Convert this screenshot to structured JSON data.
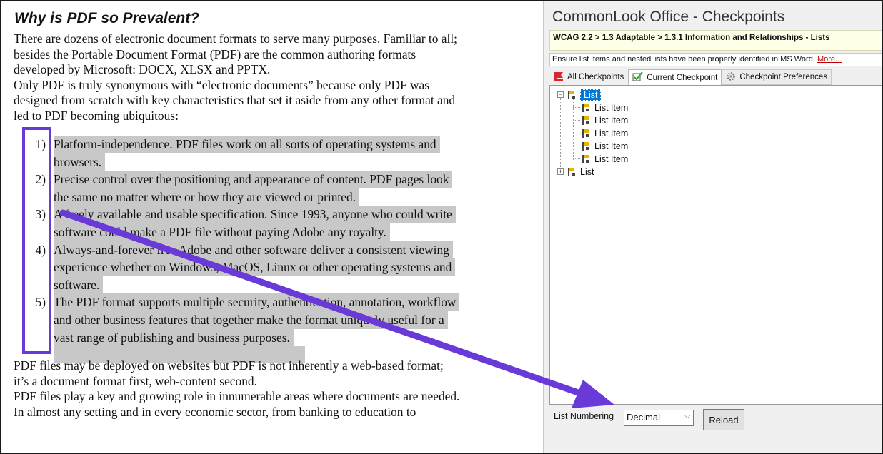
{
  "document": {
    "heading": "Why is PDF so Prevalent?",
    "intro_lines": [
      "There are dozens of electronic document formats to serve many purposes. Familiar to all;",
      "besides the Portable Document Format (PDF) are the common authoring formats",
      "developed by Microsoft: DOCX, XLSX and PPTX.",
      "Only PDF is truly synonymous with “electronic documents” because only PDF was",
      "designed from scratch with key characteristics that set it aside from any other format and",
      "led to PDF becoming ubiquitous:"
    ],
    "list_items": [
      {
        "number": "1)",
        "lines": [
          "Platform-independence. PDF files work on all sorts of operating systems and",
          "browsers."
        ]
      },
      {
        "number": "2)",
        "lines": [
          "Precise control over the positioning and appearance of content. PDF pages look",
          "the same no matter where or how they are viewed or printed."
        ]
      },
      {
        "number": "3)",
        "lines": [
          "A freely available and usable specification. Since 1993, anyone who could write",
          "software could make a PDF file without paying Adobe any royalty."
        ]
      },
      {
        "number": "4)",
        "lines": [
          "Always-and-forever free Adobe and other software deliver a consistent viewing",
          "experience whether on Windows, MacOS, Linux or other operating systems and",
          "software."
        ]
      },
      {
        "number": "5)",
        "lines": [
          "The PDF format supports multiple security, authentication, annotation, workflow",
          "and other business features that together make the format uniquely useful for a",
          "vast range of publishing and business purposes."
        ]
      }
    ],
    "outro_lines": [
      "PDF files may be deployed on websites but PDF is not inherently a web-based format;",
      "it’s a document format first, web-content second.",
      "PDF files play a key and growing role in innumerable areas where documents are needed.",
      "In almost any setting and in every economic sector, from banking to education to"
    ]
  },
  "commonlook": {
    "title": "CommonLook Office - Checkpoints",
    "breadcrumb": "WCAG 2.2 > 1.3 Adaptable > 1.3.1 Information and Relationships - Lists",
    "description": "Ensure list items and nested lists have been properly identified in MS Word.",
    "more_link": "More...",
    "tabs": [
      {
        "label": "All Checkpoints",
        "icon": "red-flag-icon"
      },
      {
        "label": "Current Checkpoint",
        "icon": "checkmark-icon"
      },
      {
        "label": "Checkpoint Preferences",
        "icon": "gear-icon"
      }
    ],
    "tree": {
      "root_label": "List",
      "children": [
        "List Item",
        "List Item",
        "List Item",
        "List Item",
        "List Item"
      ],
      "second_label": "List"
    },
    "list_numbering_label": "List Numbering",
    "list_numbering_value": "Decimal",
    "reload_label": "Reload"
  },
  "colors": {
    "highlight": "#c8c8c8",
    "annotation": "#6a3ad8",
    "selection": "#0078d7",
    "more_link": "#c00000"
  }
}
